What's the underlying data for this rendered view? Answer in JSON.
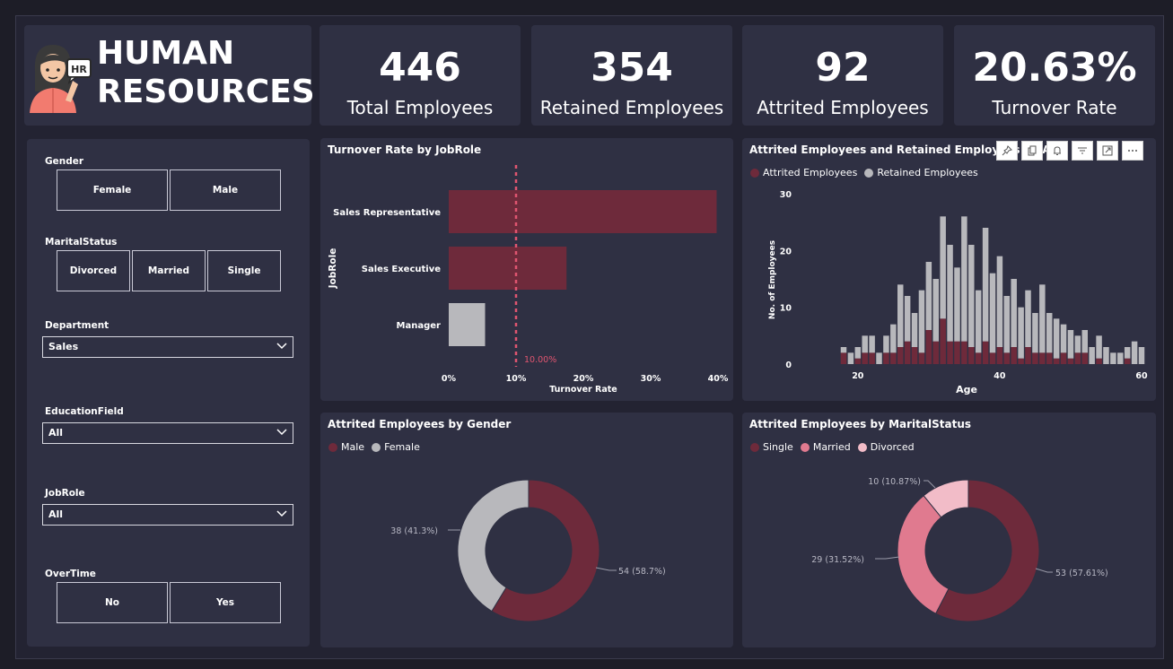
{
  "header": {
    "title_line1": "HUMAN",
    "title_line2": "RESOURCES",
    "icon_badge": "HR"
  },
  "kpis": [
    {
      "value": "446",
      "label": "Total Employees"
    },
    {
      "value": "354",
      "label": "Retained Employees"
    },
    {
      "value": "92",
      "label": "Attrited Employees"
    },
    {
      "value": "20.63%",
      "label": "Turnover Rate"
    }
  ],
  "filters": {
    "gender": {
      "label": "Gender",
      "options": [
        "Female",
        "Male"
      ]
    },
    "marital": {
      "label": "MaritalStatus",
      "options": [
        "Divorced",
        "Married",
        "Single"
      ]
    },
    "department": {
      "label": "Department",
      "value": "Sales"
    },
    "education": {
      "label": "EducationField",
      "value": "All"
    },
    "jobrole": {
      "label": "JobRole",
      "value": "All"
    },
    "overtime": {
      "label": "OverTime",
      "options": [
        "No",
        "Yes"
      ]
    }
  },
  "colors": {
    "attrited": "#6e2a3b",
    "retained": "#b8b8bc",
    "married": "#e07a8f",
    "divorced": "#f2bcc8",
    "reference": "#e05570"
  },
  "toolbar_icons": [
    "pin-icon",
    "copy-icon",
    "bell-icon",
    "filter-icon",
    "focus-mode-icon",
    "more-options-icon"
  ],
  "chart_data": [
    {
      "type": "bar",
      "orientation": "horizontal",
      "title": "Turnover Rate by JobRole",
      "xlabel": "Turnover Rate",
      "ylabel": "JobRole",
      "categories": [
        "Sales Representative",
        "Sales Executive",
        "Manager"
      ],
      "values": [
        39.8,
        17.5,
        5.4
      ],
      "colors": [
        "#6e2a3b",
        "#6e2a3b",
        "#b8b8bc"
      ],
      "xlim": [
        0,
        40
      ],
      "xticks": [
        "0%",
        "10%",
        "20%",
        "30%",
        "40%"
      ],
      "reference_line": {
        "value": 10,
        "label": "10.00%"
      }
    },
    {
      "type": "bar",
      "stacked": true,
      "title": "Attrited Employees and Retained Employees by Ag",
      "xlabel": "Age",
      "ylabel": "No. of Employees",
      "ylim": [
        0,
        30
      ],
      "yticks": [
        "0",
        "10",
        "20",
        "30"
      ],
      "xticks": [
        "20",
        "40",
        "60"
      ],
      "x": [
        18,
        19,
        20,
        21,
        22,
        23,
        24,
        25,
        26,
        27,
        28,
        29,
        30,
        31,
        32,
        33,
        34,
        35,
        36,
        37,
        38,
        39,
        40,
        41,
        42,
        43,
        44,
        45,
        46,
        47,
        48,
        49,
        50,
        51,
        52,
        53,
        54,
        55,
        56,
        57,
        58,
        59,
        60
      ],
      "series": [
        {
          "name": "Attrited Employees",
          "values": [
            2,
            0,
            1,
            2,
            2,
            0,
            2,
            2,
            3,
            4,
            3,
            2,
            6,
            4,
            8,
            4,
            4,
            4,
            3,
            2,
            4,
            2,
            3,
            2,
            3,
            1,
            3,
            2,
            2,
            2,
            1,
            2,
            1,
            2,
            2,
            0,
            1,
            0,
            0,
            0,
            1,
            0,
            0
          ]
        },
        {
          "name": "Retained Employees",
          "values": [
            1,
            2,
            2,
            3,
            3,
            2,
            3,
            5,
            11,
            8,
            6,
            11,
            12,
            11,
            18,
            17,
            13,
            22,
            18,
            11,
            20,
            14,
            16,
            10,
            12,
            9,
            10,
            7,
            12,
            7,
            7,
            5,
            5,
            3,
            4,
            3,
            4,
            3,
            2,
            2,
            2,
            4,
            3
          ]
        }
      ]
    },
    {
      "type": "pie",
      "donut": true,
      "title": "Attrited Employees by Gender",
      "labels": [
        "Male",
        "Female"
      ],
      "values": [
        54,
        38
      ],
      "data_labels": [
        "54 (58.7%)",
        "38 (41.3%)"
      ],
      "colors": [
        "#6e2a3b",
        "#b8b8bc"
      ]
    },
    {
      "type": "pie",
      "donut": true,
      "title": "Attrited Employees by MaritalStatus",
      "labels": [
        "Single",
        "Married",
        "Divorced"
      ],
      "values": [
        53,
        29,
        10
      ],
      "data_labels": [
        "53 (57.61%)",
        "29 (31.52%)",
        "10 (10.87%)"
      ],
      "colors": [
        "#6e2a3b",
        "#e07a8f",
        "#f2bcc8"
      ]
    }
  ]
}
